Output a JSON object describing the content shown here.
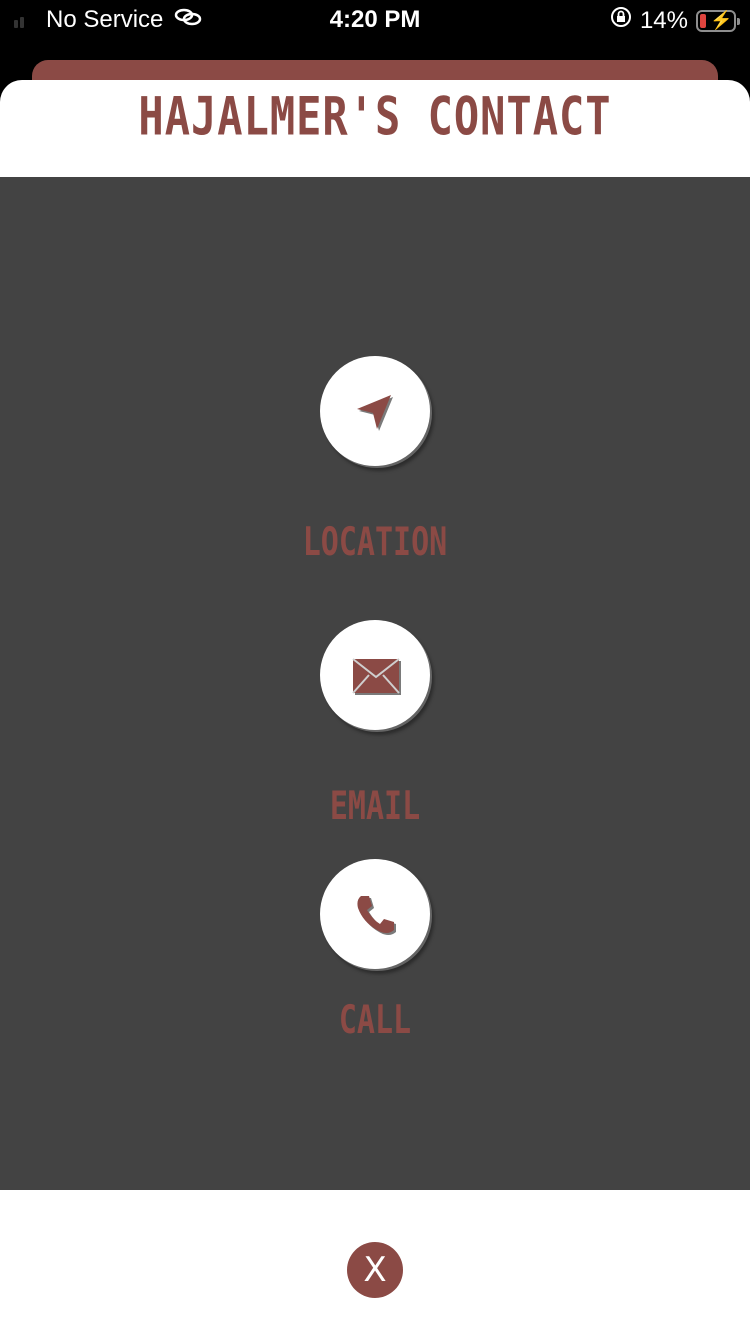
{
  "status_bar": {
    "carrier": "No Service",
    "time": "4:20 PM",
    "battery_percent": "14%",
    "icons": [
      "signal-icon",
      "link-icon",
      "orientation-lock-icon",
      "battery-charging-icon"
    ]
  },
  "modal": {
    "title": "HAJALMER'S CONTACT",
    "actions": [
      {
        "label": "LOCATION",
        "icon": "navigation-arrow-icon"
      },
      {
        "label": "EMAIL",
        "icon": "envelope-icon"
      },
      {
        "label": "CALL",
        "icon": "phone-icon"
      }
    ],
    "close_label": "X"
  },
  "colors": {
    "accent": "#8b4a45",
    "content_bg": "#434343",
    "surface": "#ffffff"
  }
}
